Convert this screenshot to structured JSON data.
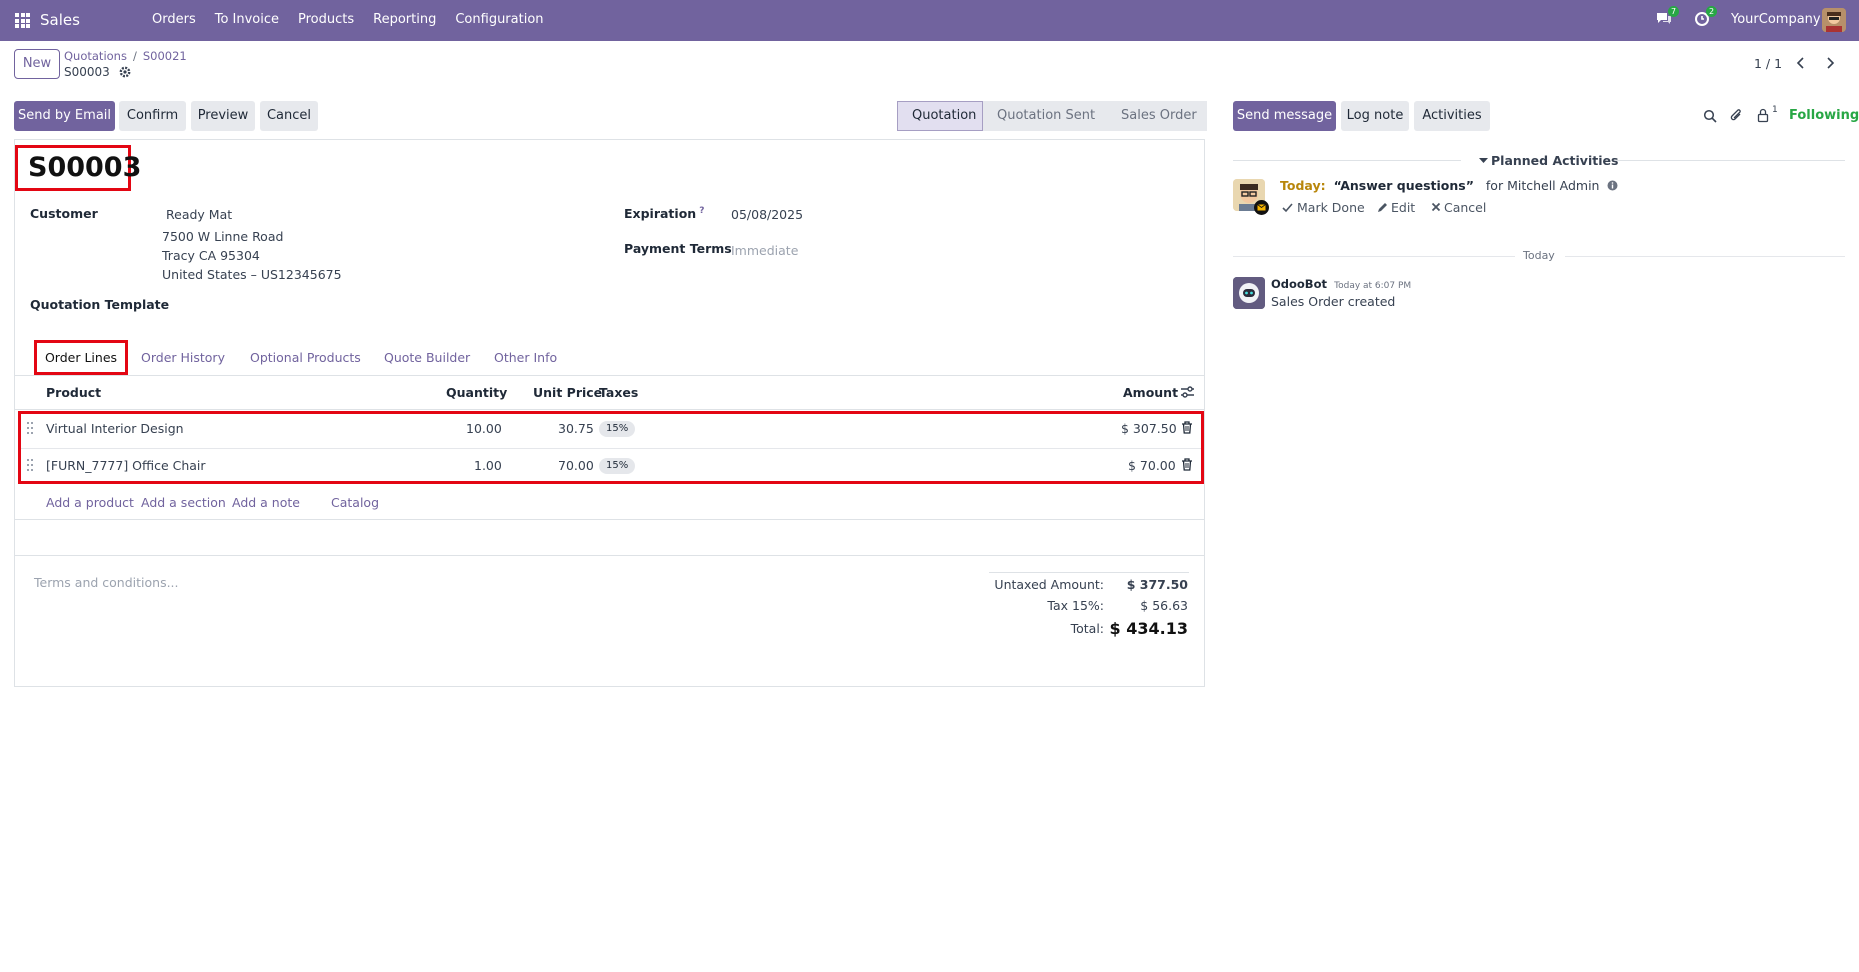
{
  "navbar": {
    "app_name": "Sales",
    "menu": [
      "Orders",
      "To Invoice",
      "Products",
      "Reporting",
      "Configuration"
    ],
    "messages_count": "7",
    "activities_count": "2",
    "company": "YourCompany"
  },
  "control": {
    "new_label": "New",
    "breadcrumb": [
      "Quotations",
      "S00021"
    ],
    "current_record": "S00003",
    "pager": "1 / 1"
  },
  "actions": {
    "send_by_email": "Send by Email",
    "confirm": "Confirm",
    "preview": "Preview",
    "cancel": "Cancel"
  },
  "statusbar": {
    "stages": [
      "Quotation",
      "Quotation Sent",
      "Sales Order"
    ],
    "active": "Quotation"
  },
  "form": {
    "name": "S00003",
    "customer_label": "Customer",
    "customer_name": "Ready Mat",
    "customer_address": [
      "7500 W Linne Road",
      "Tracy CA 95304",
      "United States – US12345675"
    ],
    "template_label": "Quotation Template",
    "expiration_label": "Expiration",
    "expiration_help": "?",
    "expiration_value": "05/08/2025",
    "payment_terms_label": "Payment Terms",
    "payment_terms_placeholder": "Immediate"
  },
  "tabs": [
    "Order Lines",
    "Order History",
    "Optional Products",
    "Quote Builder",
    "Other Info"
  ],
  "order_lines": {
    "columns": [
      "Product",
      "Quantity",
      "Unit Price",
      "Taxes",
      "Amount"
    ],
    "rows": [
      {
        "product": "Virtual Interior Design",
        "quantity": "10.00",
        "unit_price": "30.75",
        "taxes": "15%",
        "amount": "$ 307.50"
      },
      {
        "product": "[FURN_7777] Office Chair",
        "quantity": "1.00",
        "unit_price": "70.00",
        "taxes": "15%",
        "amount": "$ 70.00"
      }
    ],
    "add_links": [
      "Add a product",
      "Add a section",
      "Add a note",
      "Catalog"
    ]
  },
  "terms_placeholder": "Terms and conditions...",
  "totals": {
    "untaxed_label": "Untaxed Amount:",
    "untaxed_value": "$ 377.50",
    "tax_label": "Tax 15%:",
    "tax_value": "$ 56.63",
    "total_label": "Total:",
    "total_value": "$ 434.13"
  },
  "chatter": {
    "send_message": "Send message",
    "log_note": "Log note",
    "activities": "Activities",
    "followers_count": "1",
    "following": "Following",
    "planned_title": "Planned Activities",
    "activity": {
      "when": "Today:",
      "summary": "“Answer questions”",
      "assignee": "for Mitchell Admin",
      "mark_done": "Mark Done",
      "edit": "Edit",
      "cancel": "Cancel"
    },
    "date_separator": "Today",
    "message": {
      "author": "OdooBot",
      "time": "Today at 6:07 PM",
      "body": "Sales Order created"
    }
  },
  "colors": {
    "brand": "#71639e",
    "highlight": "#e30613",
    "following": "#28a745"
  }
}
